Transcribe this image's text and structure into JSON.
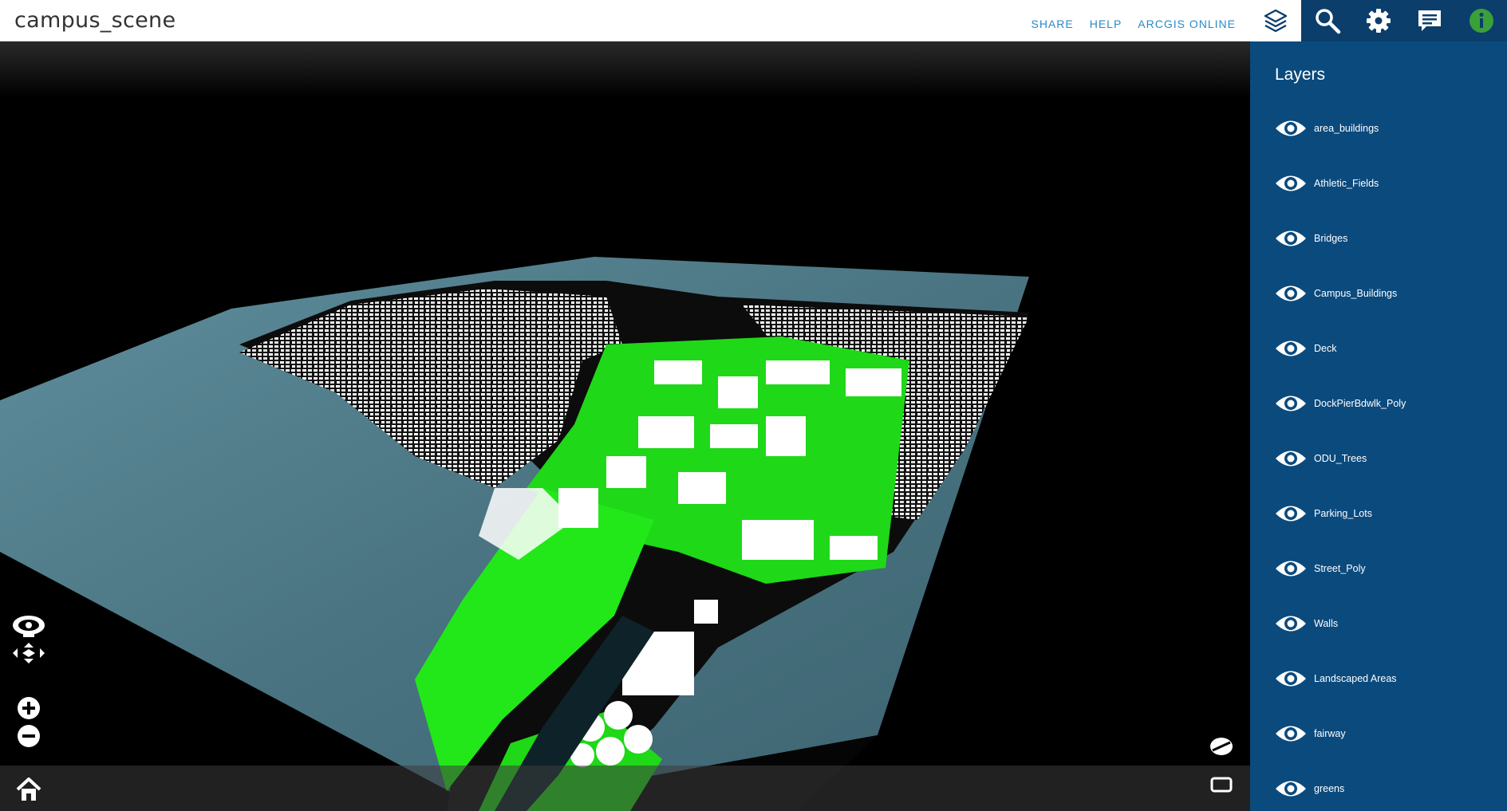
{
  "header": {
    "title": "campus_scene",
    "links": [
      "SHARE",
      "HELP",
      "ARCGIS ONLINE"
    ]
  },
  "toolbar": {
    "buttons": [
      "layers-icon",
      "search-icon",
      "gear-icon",
      "comment-icon",
      "info-icon"
    ],
    "active": "layers-icon"
  },
  "panel": {
    "title": "Layers",
    "layers": [
      "area_buildings",
      "Athletic_Fields",
      "Bridges",
      "Campus_Buildings",
      "Deck",
      "DockPierBdwlk_Poly",
      "ODU_Trees",
      "Parking_Lots",
      "Street_Poly",
      "Walls",
      "Landscaped Areas",
      "fairway",
      "greens"
    ]
  },
  "nav_controls": [
    "pan-icon",
    "rotate-icon",
    "zoom-in-icon",
    "zoom-out-icon",
    "home-icon",
    "compass-icon",
    "fullscreen-icon"
  ],
  "colors": {
    "header_bg": "#ffffff",
    "link": "#2a8ac6",
    "toolbar_bg": "#0b3e6b",
    "panel_bg": "#0b4a7d",
    "water": "#4f7885",
    "vegetation": "#22e81a",
    "buildings": "#ffffff"
  }
}
